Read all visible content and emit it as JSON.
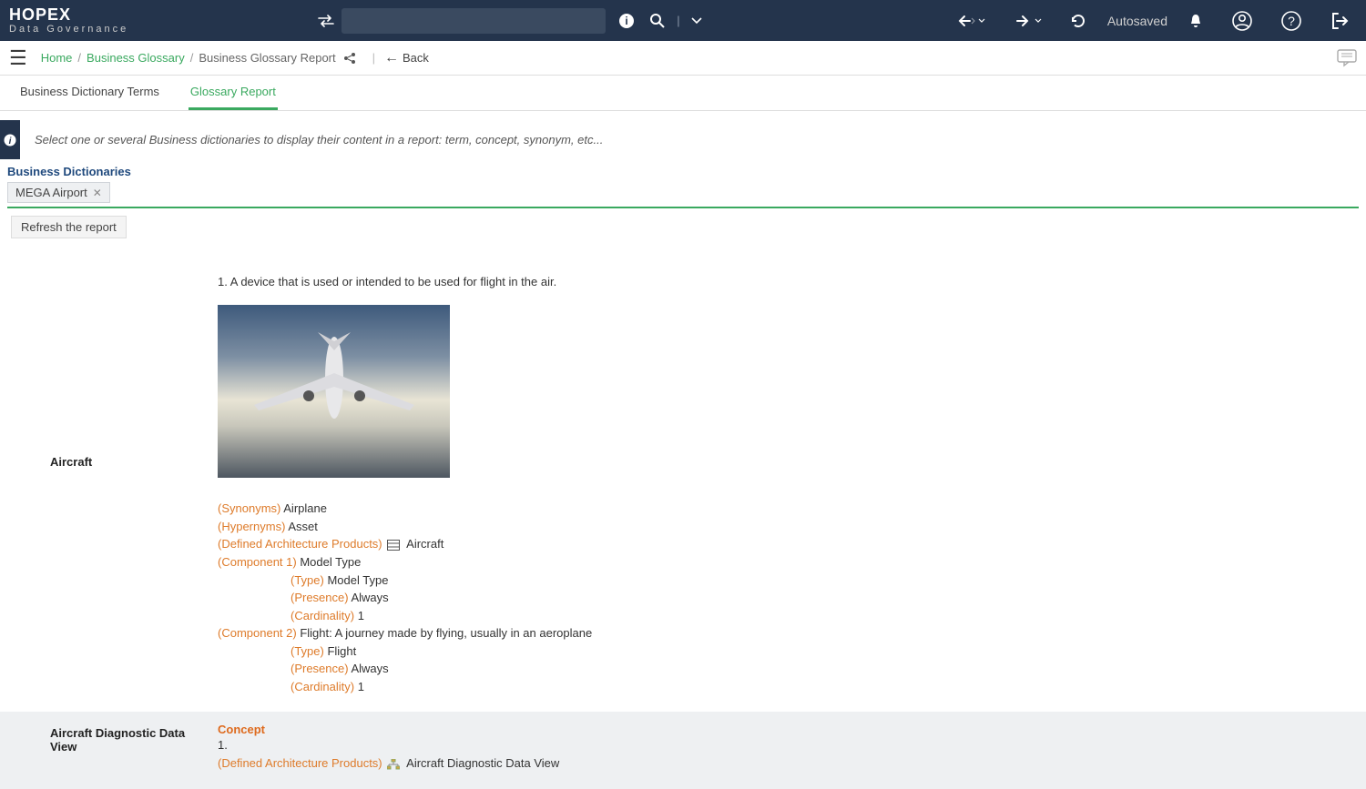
{
  "header": {
    "logo_main": "HOPEX",
    "logo_sub": "Data Governance",
    "search_placeholder": "",
    "autosaved": "Autosaved"
  },
  "breadcrumb": {
    "items": [
      "Home",
      "Business Glossary",
      "Business Glossary Report"
    ],
    "back_label": "Back"
  },
  "tabs": [
    {
      "label": "Business Dictionary Terms",
      "active": false
    },
    {
      "label": "Glossary Report",
      "active": true
    }
  ],
  "info_bar": "Select one or several Business dictionaries to display their content in a report: term, concept, synonym, etc...",
  "dictionaries": {
    "heading": "Business Dictionaries",
    "chips": [
      "MEGA Airport"
    ],
    "refresh_label": "Refresh the report"
  },
  "report": {
    "rows": [
      {
        "term": "Aircraft",
        "definition_num": "1.",
        "definition": "A device that is used or intended to be used for flight in the air.",
        "synonyms_label": "(Synonyms)",
        "synonyms_value": "Airplane",
        "hypernyms_label": "(Hypernyms)",
        "hypernyms_value": "Asset",
        "dap_label": "(Defined Architecture Products)",
        "dap_value": "Aircraft",
        "comp1_label": "(Component 1)",
        "comp1_value": "Model Type",
        "comp1_type_label": "(Type)",
        "comp1_type_value": "Model Type",
        "comp1_presence_label": "(Presence)",
        "comp1_presence_value": "Always",
        "comp1_card_label": "(Cardinality)",
        "comp1_card_value": "1",
        "comp2_label": "(Component 2)",
        "comp2_value": "Flight: A journey made by flying, usually in an aeroplane",
        "comp2_type_label": "(Type)",
        "comp2_type_value": "Flight",
        "comp2_presence_label": "(Presence)",
        "comp2_presence_value": "Always",
        "comp2_card_label": "(Cardinality)",
        "comp2_card_value": "1"
      },
      {
        "term": "Aircraft Diagnostic Data View",
        "concept_label": "Concept",
        "definition_num": "1.",
        "dap_label": "(Defined Architecture Products)",
        "dap_value": "Aircraft Diagnostic Data View"
      }
    ]
  }
}
